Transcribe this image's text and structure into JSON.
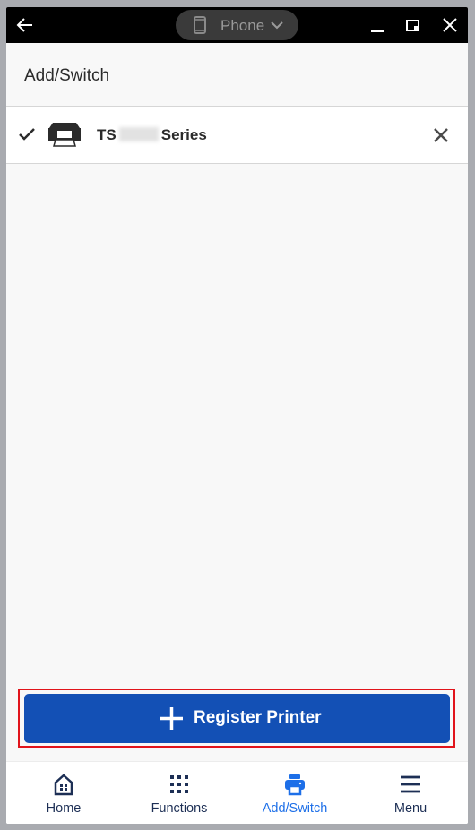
{
  "titlebar": {
    "device_label": "Phone",
    "back_icon": "arrow-left-icon",
    "device_icon": "phone-icon",
    "minimize_icon": "minimize-icon",
    "restore_icon": "restore-window-icon",
    "close_icon": "close-icon"
  },
  "header": {
    "title": "Add/Switch"
  },
  "printers": [
    {
      "prefix": "TS",
      "suffix": "Series",
      "selected": true,
      "model_obscured": true
    }
  ],
  "register_button": {
    "label": "Register Printer",
    "icon": "plus-icon"
  },
  "bottom_nav": {
    "items": [
      {
        "label": "Home",
        "icon": "home-icon",
        "active": false
      },
      {
        "label": "Functions",
        "icon": "grid-icon",
        "active": false
      },
      {
        "label": "Add/Switch",
        "icon": "printer-icon",
        "active": true
      },
      {
        "label": "Menu",
        "icon": "menu-icon",
        "active": false
      }
    ]
  },
  "colors": {
    "primary_button": "#1350b5",
    "active_nav": "#1d6fe8",
    "inactive_nav": "#1d2f55",
    "highlight_border": "#e1141b"
  }
}
